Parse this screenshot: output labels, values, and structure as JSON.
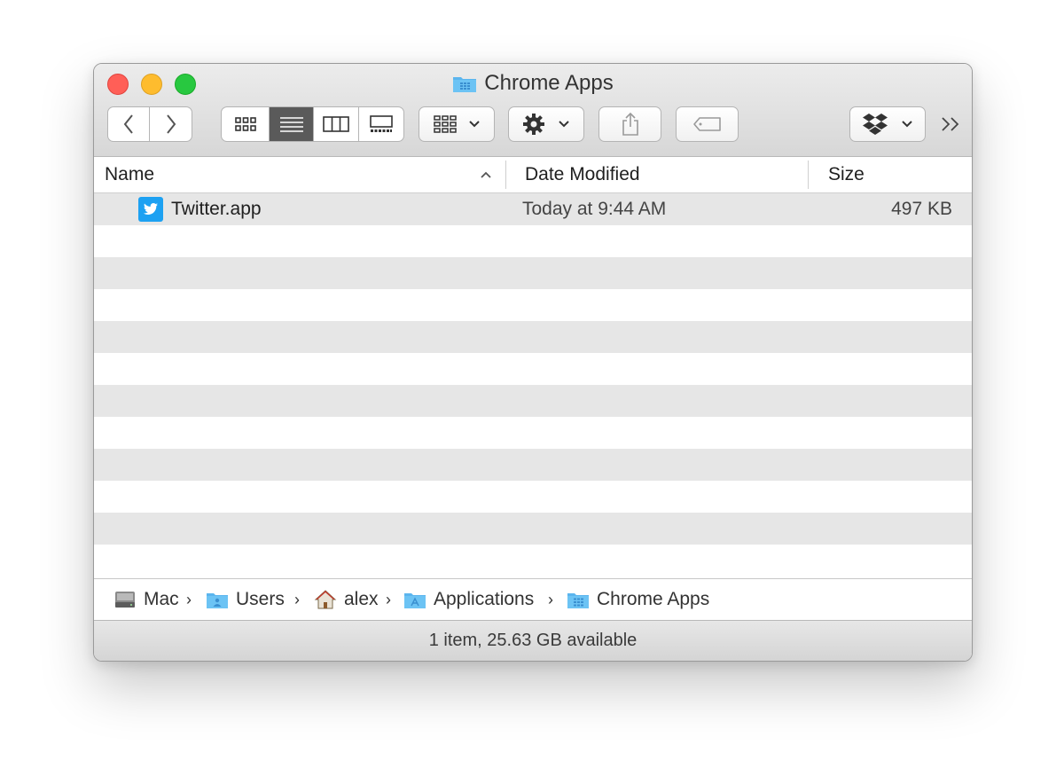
{
  "window": {
    "title": "Chrome Apps"
  },
  "toolbar": {
    "icons": [
      "back-icon",
      "forward-icon",
      "icon-view-icon",
      "list-view-icon",
      "column-view-icon",
      "gallery-view-icon",
      "group-icon",
      "gear-icon",
      "share-icon",
      "tag-icon",
      "dropbox-icon",
      "more-icon"
    ]
  },
  "columns": {
    "name": "Name",
    "date": "Date Modified",
    "size": "Size"
  },
  "files": [
    {
      "name": "Twitter.app",
      "date": "Today at 9:44 AM",
      "size": "497 KB",
      "icon": "twitter-icon"
    }
  ],
  "path": [
    {
      "label": "Mac",
      "icon": "disk-icon"
    },
    {
      "label": "Users",
      "icon": "folder-icon"
    },
    {
      "label": "alex",
      "icon": "home-icon"
    },
    {
      "label": "Applications",
      "icon": "applications-folder-icon"
    },
    {
      "label": "Chrome Apps",
      "icon": "folder-icon"
    }
  ],
  "status": {
    "text": "1 item, 25.63 GB available"
  },
  "colors": {
    "folder": "#5bb5ee",
    "twitter": "#1da1f2",
    "selected_view": "#5a5a5a"
  }
}
